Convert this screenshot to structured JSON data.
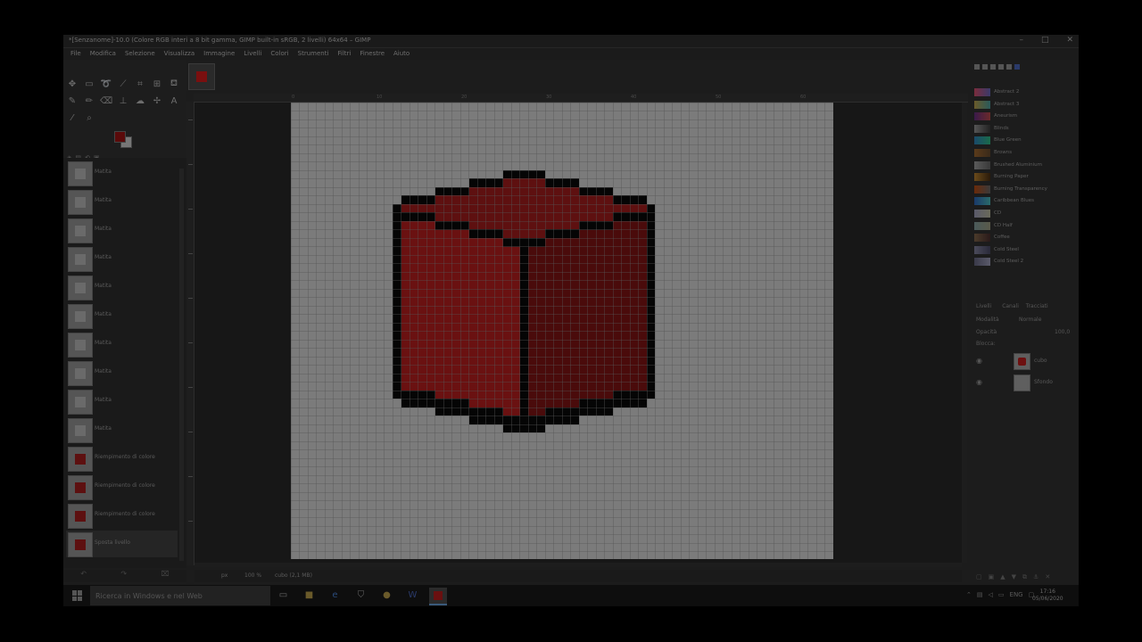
{
  "window": {
    "title": "*[Senzanome]-10.0 (Colore RGB interi a 8 bit gamma, GIMP built-in sRGB, 2 livelli) 64x64 – GIMP",
    "controls": [
      "–",
      "□",
      "✕"
    ]
  },
  "menu": [
    "File",
    "Modifica",
    "Selezione",
    "Visualizza",
    "Immagine",
    "Livelli",
    "Colori",
    "Strumenti",
    "Filtri",
    "Finestre",
    "Aiuto"
  ],
  "tools": [
    "move-tool-icon",
    "rect-select-icon",
    "lasso-icon",
    "fuzzy-select-icon",
    "crop-icon",
    "warp-transform-icon",
    "bucket-fill-icon",
    "paintbrush-icon",
    "pencil-icon",
    "eraser-icon",
    "clone-icon",
    "smudge-icon",
    "path-icon",
    "text-icon",
    "color-picker-icon",
    "zoom-icon"
  ],
  "colors": {
    "foreground": "#5a0a0a",
    "background": "#777777",
    "canvas_bg": "#7b7b7b",
    "cube_front_left": "#6a1111",
    "cube_front_right": "#4a0b0b",
    "cube_top": "#5e1010",
    "outline": "#050505"
  },
  "undo_history": [
    {
      "label": "Matita",
      "red": false
    },
    {
      "label": "Matita",
      "red": false
    },
    {
      "label": "Matita",
      "red": false
    },
    {
      "label": "Matita",
      "red": false
    },
    {
      "label": "Matita",
      "red": false
    },
    {
      "label": "Matita",
      "red": false
    },
    {
      "label": "Matita",
      "red": false
    },
    {
      "label": "Matita",
      "red": false
    },
    {
      "label": "Matita",
      "red": false
    },
    {
      "label": "Matita",
      "red": false
    },
    {
      "label": "Riempimento di colore",
      "red": true
    },
    {
      "label": "Riempimento di colore",
      "red": true
    },
    {
      "label": "Riempimento di colore",
      "red": true
    },
    {
      "label": "Sposta livello",
      "red": true
    }
  ],
  "status": {
    "unit": "px",
    "zoom": "100 %",
    "info": "cubo (2,1 MB)"
  },
  "gradients": [
    {
      "name": "Abstract 2",
      "c1": "#7a2c3c",
      "c2": "#3a3a6a"
    },
    {
      "name": "Abstract 3",
      "c1": "#6a5a2a",
      "c2": "#2a5a5a"
    },
    {
      "name": "Aneurism",
      "c1": "#3a1a4a",
      "c2": "#6a2a2a"
    },
    {
      "name": "Blinds",
      "c1": "#555555",
      "c2": "#222222"
    },
    {
      "name": "Blue Green",
      "c1": "#1a4a6a",
      "c2": "#1a6a4a"
    },
    {
      "name": "Browns",
      "c1": "#5a3a1a",
      "c2": "#3a2a1a"
    },
    {
      "name": "Brushed Aluminium",
      "c1": "#5a5a5a",
      "c2": "#3a3a3a"
    },
    {
      "name": "Burning Paper",
      "c1": "#6a4a1a",
      "c2": "#2a1a0a"
    },
    {
      "name": "Burning Transparency",
      "c1": "#6a2a0a",
      "c2": "#3a3a3a"
    },
    {
      "name": "Caribbean Blues",
      "c1": "#1a3a6a",
      "c2": "#2a6a6a"
    },
    {
      "name": "CD",
      "c1": "#5a5a6a",
      "c2": "#6a6a5a"
    },
    {
      "name": "CD Half",
      "c1": "#4a5a5a",
      "c2": "#5a5a4a"
    },
    {
      "name": "Coffee",
      "c1": "#4a3a2a",
      "c2": "#2a1a1a"
    },
    {
      "name": "Cold Steel",
      "c1": "#4a4a5a",
      "c2": "#2a2a3a"
    },
    {
      "name": "Cold Steel 2",
      "c1": "#3a3a4a",
      "c2": "#5a5a6a"
    }
  ],
  "layers_panel": {
    "tabs": [
      "Livelli",
      "Canali",
      "Tracciati"
    ],
    "mode_label": "Modalità",
    "mode": "Normale",
    "opacity_label": "Opacità",
    "opacity": "100,0",
    "lock_label": "Blocca:",
    "layers": [
      {
        "name": "cubo",
        "visible": true,
        "thumb": "cube"
      },
      {
        "name": "Sfondo",
        "visible": true,
        "thumb": "plain"
      }
    ]
  },
  "taskbar": {
    "search_placeholder": "Ricerca in Windows e nel Web",
    "lang": "ENG",
    "time": "17:16",
    "date": "05/06/2020"
  },
  "ruler_labels": [
    "0",
    "10",
    "20",
    "30",
    "40",
    "50",
    "60"
  ],
  "image_size": {
    "cols": 64,
    "rows": 54
  }
}
